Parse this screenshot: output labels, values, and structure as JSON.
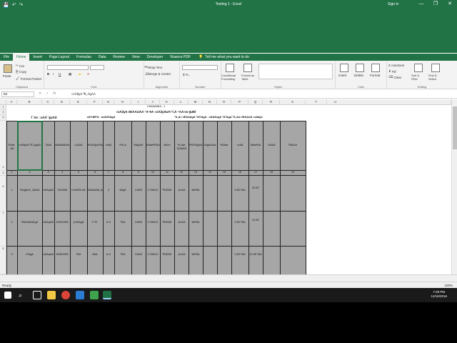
{
  "window": {
    "title": "Testing 1 - Excel",
    "sign_in": "Sign in",
    "minimize": "—",
    "restore": "❐",
    "close": "✕"
  },
  "qat": {
    "save": "💾",
    "undo": "↶",
    "redo": "↷"
  },
  "tabs": [
    "File",
    "Home",
    "Insert",
    "Page Layout",
    "Formulas",
    "Data",
    "Review",
    "View",
    "Developer",
    "Nuance PDF"
  ],
  "active_tab": "Home",
  "tell_me": "Tell me what you want to do",
  "ribbon": {
    "clipboard": {
      "paste": "Paste",
      "cut": "Cut",
      "copy": "Copy",
      "format_painter": "Format Painter",
      "label": "Clipboard"
    },
    "font": {
      "name": "",
      "size": "",
      "bold": "B",
      "italic": "I",
      "underline": "U",
      "label": "Font"
    },
    "alignment": {
      "wrap": "Wrap Text",
      "merge": "Merge & Center",
      "label": "Alignment"
    },
    "number": {
      "format": "",
      "label": "Number"
    },
    "styles": {
      "conditional": "Conditional Formatting",
      "table": "Format as Table",
      "label": "Styles"
    },
    "cells": {
      "insert": "Insert",
      "delete": "Delete",
      "format": "Format",
      "label": "Cells"
    },
    "editing": {
      "autosum": "AutoSum",
      "fill": "Fill",
      "clear": "Clear",
      "sort": "Sort & Filter",
      "find": "Find & Select",
      "label": "Editing"
    }
  },
  "formula_bar": {
    "name_box": "B4",
    "cancel": "✕",
    "enter": "✓",
    "fx": "fx",
    "formula": "«zÄåyö ªÉ¸ÁgÀÀ"
  },
  "columns": [
    "A",
    "B",
    "C",
    "D",
    "E",
    "F",
    "G",
    "H",
    "I",
    "J",
    "K",
    "L",
    "M",
    "N",
    "O",
    "P",
    "Q",
    "R",
    "S",
    "T",
    "U"
  ],
  "rows": [
    "1",
    "2",
    "3",
    "4",
    "5",
    "6",
    "7",
    "8",
    "9",
    "10",
    "11"
  ],
  "sheet": {
    "r1": "CAÁAÀ¥ÀA - 1",
    "r2": "«zÀåyö ¤ÉÁAUÀÁ °A°ëÀ «zÀåyöUÀ°¼À °AÁ«w §UÉÌ",
    "r3_left": "f¯Áè : UÁÃ¯§UÁð",
    "r3_mid": "vÁ®ÆPÀ : avÁÛ¥ÁgÀ",
    "r3_right": "ºÁ¸Á« ¤ÉÁAÁgÀ ªÁ®ÁgÀ : ¤ÁÃÀ¤gÀ ºÁªÁgÀ ªÀ¸Áw ¤ÉÁAUÀ «zÀåyö"
  },
  "headers": [
    "PÀæ. ¸ÀA",
    "«zÀåyöð ºÉ¸ÀgÀÄ",
    "°ÀAÀ",
    "d£ÀäÀ¢£ÀA",
    "CAiÀÄ",
    "¥ÉÆÃµÀPÀgÀ",
    "»A§¢",
    "¤ªÁ¸À",
    "¥ÀgÀÆ",
    "¥ÀÀæªÉÃ±À",
    "¥À¤ð",
    "ºÀ¸Àæ ¨ÁVAiÀÄ",
    "PÀ®ÆgÀÄ",
    "vÀgÀUÀw",
    "ªÀiÁæ",
    "«zÁå",
    "¥ÀæªÀÄ",
    "°AAÀÀ",
    "ªÀiÁvÀ"
  ],
  "header_nums": [
    "1",
    "2",
    "3",
    "4",
    "5",
    "6",
    "7",
    "8",
    "9",
    "10",
    "11",
    "12",
    "13",
    "14",
    "15",
    "16",
    "17",
    "18",
    "19"
  ],
  "data_rows": [
    {
      "sl": "1",
      "name": "ºÀdgÀvÀ ¸ÀÀÀÀ",
      "c": "UÀAqÀÄ",
      "d": "7/6/1996",
      "e": "CzÀÄªÀ ÀÀ",
      "f": "ªÀÄAiÀÄÄ¸ÀA",
      "g": "2",
      "h": "¥ÀgÀ",
      "i": "13000",
      "j": "17/08/12",
      "k": "ªÉÆÃÀ",
      "l": "¸À¤ÀÁ",
      "m": "¥ÁªÀÁ",
      "n": "3 £É.ªÀÁ",
      "o": "20 £É"
    },
    {
      "sl": "2",
      "name": "ªÀÄAiÀÄÆgÀ",
      "c": "UÀAqÀÄ",
      "d": "15/5/1996",
      "e": "§.¥ÀÁgÀ",
      "f": "©.Pï.",
      "g": "8 Á",
      "h": "ªÀÄ",
      "i": "13000",
      "j": "17/08/12",
      "k": "ªÉÆÃÀ",
      "l": "¸À¤ÀÁ",
      "m": "¥ÁªÀÁ",
      "n": "3 £É.ªÀÁ",
      "o": "23 £É"
    },
    {
      "sl": "3",
      "name": "¤ªÀgÀ",
      "c": "UÀAqÀÄ",
      "d": "26/8/1996",
      "e": "ªÀÁ",
      "f": "¥ÀÁ",
      "g": "8 Á",
      "h": "ªÀÄ",
      "i": "13000",
      "j": "17/08/12",
      "k": "ªÉÆÃÀ",
      "l": "¸À¤ÀÁ",
      "m": "¥ÁªÀÁ",
      "n": "3 £É.ªÀÁ",
      "o": "12 £É.ªÀÁ"
    }
  ],
  "status": {
    "ready": "Ready",
    "zoom": "100%"
  },
  "clock": {
    "time": "7:28 PM",
    "date": "12/16/2016"
  }
}
